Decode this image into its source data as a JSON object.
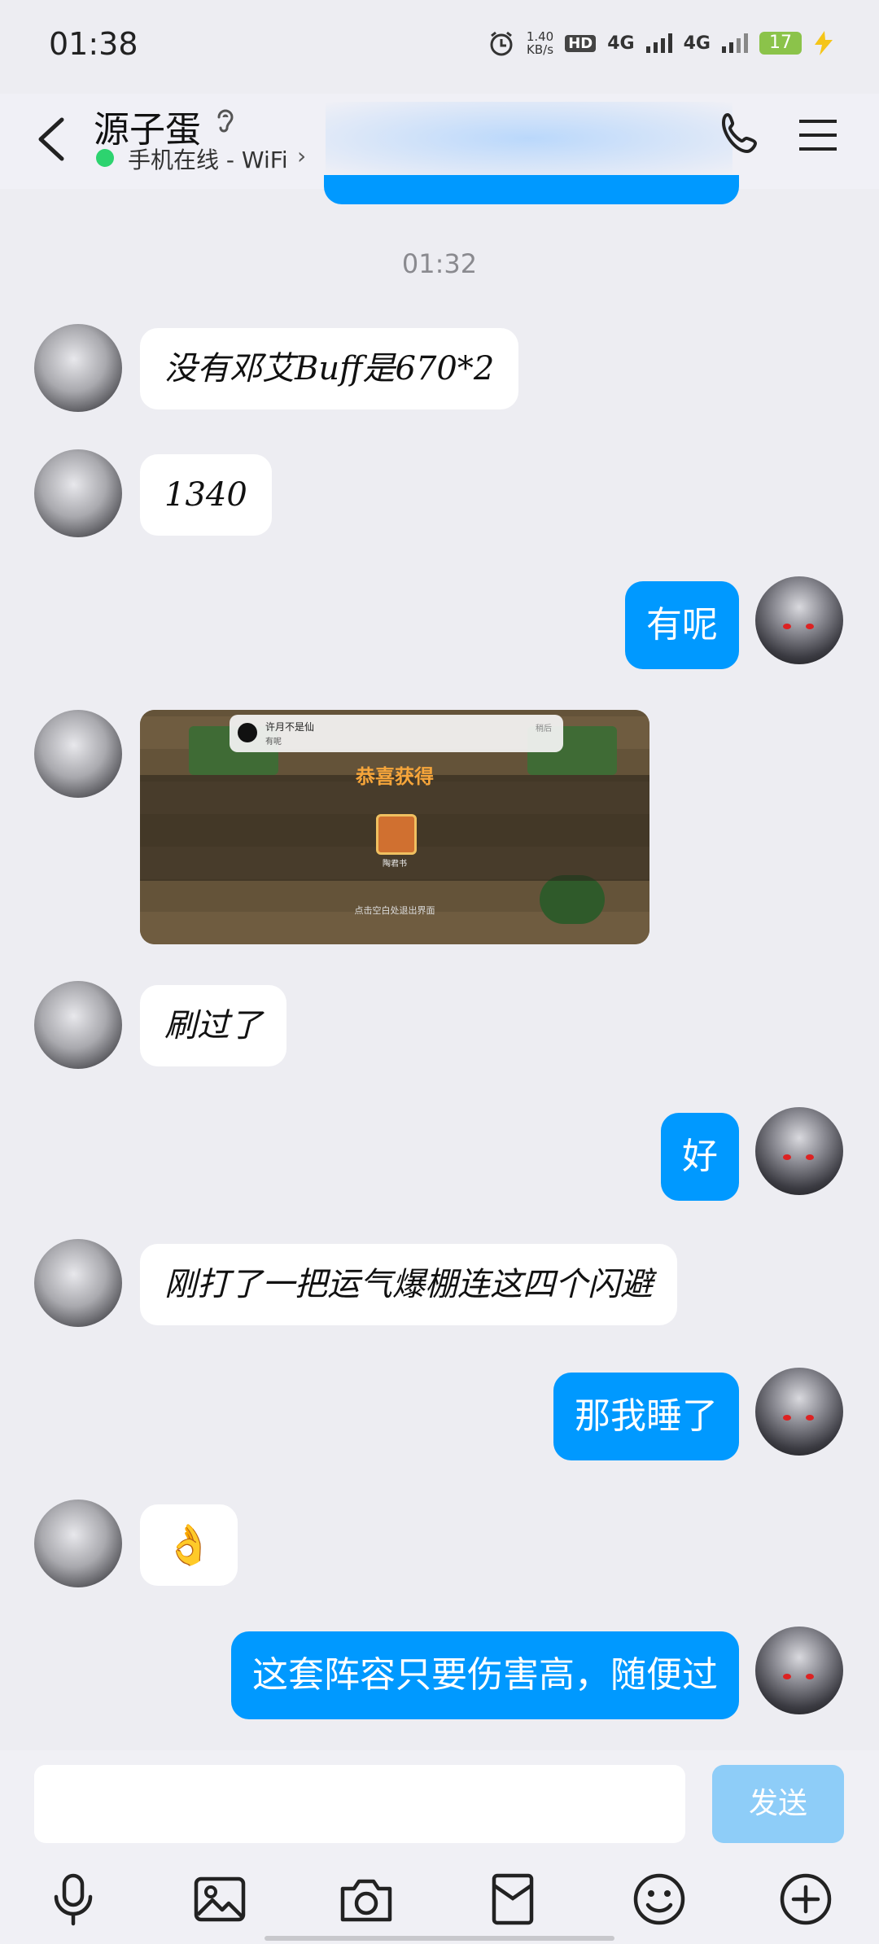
{
  "status_bar": {
    "time": "01:38",
    "net_speed_value": "1.40",
    "net_speed_unit": "KB/s",
    "hd_label": "HD",
    "sim1": "4G",
    "sim2": "4G",
    "battery": "17"
  },
  "header": {
    "contact_name": "源子蛋",
    "online_status": "手机在线 - WiFi",
    "online_color": "#2DD36F"
  },
  "messages": {
    "timestamp": "01:32",
    "m1": "没有邓艾Buff是670*2",
    "m2": "1340",
    "m3": "有呢",
    "m5": "刷过了",
    "m6": "好",
    "m7": "刚打了一把运气爆棚连这四个闪避",
    "m8": "那我睡了",
    "m9": "👌",
    "m10": "这套阵容只要伤害高，随便过"
  },
  "image_message": {
    "notif_sender": "许月不是仙",
    "notif_text": "有呢",
    "notif_action": "稍后",
    "title": "恭喜获得",
    "item_label": "陶君书",
    "hint": "点击空白处退出界面"
  },
  "input": {
    "placeholder": "",
    "send_label": "发送",
    "send_color": "#8ECDF8"
  },
  "toolbar": {
    "icons": [
      "microphone-icon",
      "image-icon",
      "camera-icon",
      "red-packet-icon",
      "emoji-icon",
      "plus-icon"
    ]
  },
  "colors": {
    "sent_bubble": "#0099FF",
    "received_bubble": "#FFFFFF",
    "background": "#EDEDF2"
  }
}
